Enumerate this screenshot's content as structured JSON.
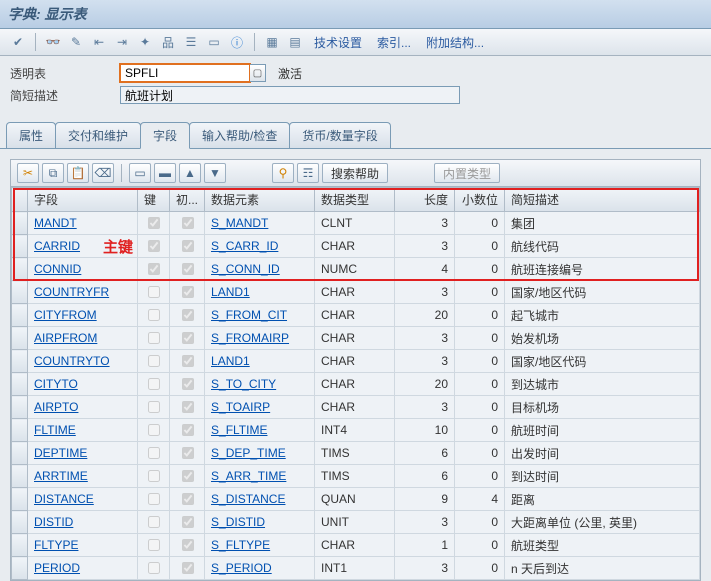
{
  "title": "字典: 显示表",
  "toolbar": {
    "tech_settings": "技术设置",
    "index": "索引...",
    "append": "附加结构..."
  },
  "form": {
    "table_label": "透明表",
    "table_value": "SPFLI",
    "status": "激活",
    "shortdesc_label": "简短描述",
    "shortdesc_value": "航班计划"
  },
  "tabs": {
    "t1": "属性",
    "t2": "交付和维护",
    "t3": "字段",
    "t4": "输入帮助/检查",
    "t5": "货币/数量字段"
  },
  "grid_toolbar": {
    "search_help": "搜索帮助",
    "builtin_type": "内置类型"
  },
  "columns": {
    "field": "字段",
    "key": "键",
    "init": "初...",
    "dataelem": "数据元素",
    "datatype": "数据类型",
    "length": "长度",
    "decimals": "小数位",
    "shortdesc": "简短描述"
  },
  "annotation": "主键",
  "rows": [
    {
      "field": "MANDT",
      "key": true,
      "init": true,
      "elem": "S_MANDT",
      "type": "CLNT",
      "len": "3",
      "dec": "0",
      "desc": "集团"
    },
    {
      "field": "CARRID",
      "key": true,
      "init": true,
      "elem": "S_CARR_ID",
      "type": "CHAR",
      "len": "3",
      "dec": "0",
      "desc": "航线代码"
    },
    {
      "field": "CONNID",
      "key": true,
      "init": true,
      "elem": "S_CONN_ID",
      "type": "NUMC",
      "len": "4",
      "dec": "0",
      "desc": "航班连接编号"
    },
    {
      "field": "COUNTRYFR",
      "key": false,
      "init": true,
      "elem": "LAND1",
      "type": "CHAR",
      "len": "3",
      "dec": "0",
      "desc": "国家/地区代码"
    },
    {
      "field": "CITYFROM",
      "key": false,
      "init": true,
      "elem": "S_FROM_CIT",
      "type": "CHAR",
      "len": "20",
      "dec": "0",
      "desc": "起飞城市"
    },
    {
      "field": "AIRPFROM",
      "key": false,
      "init": true,
      "elem": "S_FROMAIRP",
      "type": "CHAR",
      "len": "3",
      "dec": "0",
      "desc": "始发机场"
    },
    {
      "field": "COUNTRYTO",
      "key": false,
      "init": true,
      "elem": "LAND1",
      "type": "CHAR",
      "len": "3",
      "dec": "0",
      "desc": "国家/地区代码"
    },
    {
      "field": "CITYTO",
      "key": false,
      "init": true,
      "elem": "S_TO_CITY",
      "type": "CHAR",
      "len": "20",
      "dec": "0",
      "desc": "到达城市"
    },
    {
      "field": "AIRPTO",
      "key": false,
      "init": true,
      "elem": "S_TOAIRP",
      "type": "CHAR",
      "len": "3",
      "dec": "0",
      "desc": "目标机场"
    },
    {
      "field": "FLTIME",
      "key": false,
      "init": true,
      "elem": "S_FLTIME",
      "type": "INT4",
      "len": "10",
      "dec": "0",
      "desc": "航班时间"
    },
    {
      "field": "DEPTIME",
      "key": false,
      "init": true,
      "elem": "S_DEP_TIME",
      "type": "TIMS",
      "len": "6",
      "dec": "0",
      "desc": "出发时间"
    },
    {
      "field": "ARRTIME",
      "key": false,
      "init": true,
      "elem": "S_ARR_TIME",
      "type": "TIMS",
      "len": "6",
      "dec": "0",
      "desc": "到达时间"
    },
    {
      "field": "DISTANCE",
      "key": false,
      "init": true,
      "elem": "S_DISTANCE",
      "type": "QUAN",
      "len": "9",
      "dec": "4",
      "desc": "距离"
    },
    {
      "field": "DISTID",
      "key": false,
      "init": true,
      "elem": "S_DISTID",
      "type": "UNIT",
      "len": "3",
      "dec": "0",
      "desc": "大距离单位 (公里, 英里)"
    },
    {
      "field": "FLTYPE",
      "key": false,
      "init": true,
      "elem": "S_FLTYPE",
      "type": "CHAR",
      "len": "1",
      "dec": "0",
      "desc": "航班类型"
    },
    {
      "field": "PERIOD",
      "key": false,
      "init": true,
      "elem": "S_PERIOD",
      "type": "INT1",
      "len": "3",
      "dec": "0",
      "desc": "n 天后到达"
    }
  ]
}
